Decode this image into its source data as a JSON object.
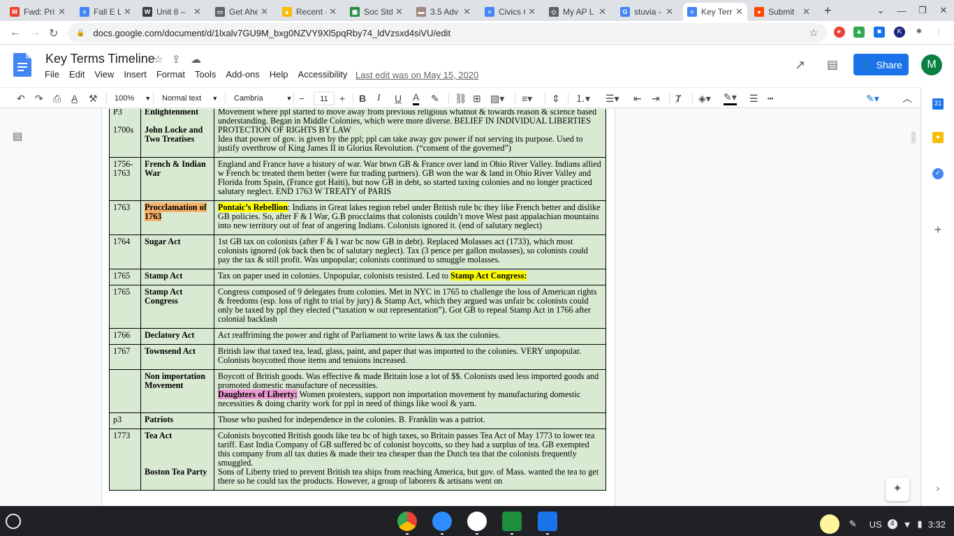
{
  "tabs": [
    {
      "title": "Fwd: Pri",
      "color": "#ea4335",
      "glyph": "M"
    },
    {
      "title": "Fall E Le",
      "color": "#4285f4",
      "glyph": "≡"
    },
    {
      "title": "Unit 8 –",
      "color": "#3c4043",
      "glyph": "W"
    },
    {
      "title": "Get Ahe",
      "color": "#5f6368",
      "glyph": "▭"
    },
    {
      "title": "Recent -",
      "color": "#fbbc04",
      "glyph": "▲"
    },
    {
      "title": "Soc Stdy",
      "color": "#1e8e3e",
      "glyph": "▣"
    },
    {
      "title": "3.5 Adv",
      "color": "#a1887f",
      "glyph": "▬"
    },
    {
      "title": "Civics C",
      "color": "#4285f4",
      "glyph": "≡"
    },
    {
      "title": "My AP L",
      "color": "#5f6368",
      "glyph": "◇"
    },
    {
      "title": "stuvia -",
      "color": "#4285f4",
      "glyph": "G"
    },
    {
      "title": "Key Terr",
      "color": "#4285f4",
      "glyph": "≡",
      "active": true
    },
    {
      "title": "Submit",
      "color": "#ff4500",
      "glyph": "●"
    }
  ],
  "browser": {
    "url": "docs.google.com/document/d/1lxalv7GU9M_bxg0NZVY9Xl5pqRby74_ldVzsxd4siVU/edit"
  },
  "doc": {
    "title": "Key Terms Timeline",
    "menu": [
      "File",
      "Edit",
      "View",
      "Insert",
      "Format",
      "Tools",
      "Add-ons",
      "Help",
      "Accessibility"
    ],
    "last_edit": "Last edit was on May 15, 2020",
    "share_label": "Share",
    "avatar_letter": "M"
  },
  "toolbar": {
    "zoom": "100%",
    "style": "Normal text",
    "font": "Cambria",
    "size": "11"
  },
  "table": {
    "rows": [
      {
        "date": "P3\n\n1700s",
        "term": "Enlightenment\n\nJohn Locke and Two Treatises",
        "desc_html": "Movement where ppl started to move away from previous religious whatnot & towards reason & science based understanding. Began in Middle Colonies, which were more diverse. BELIEF IN INDIVIDUAL LIBERTIES PROTECTION OF RIGHTS BY LAW<br>Idea that power of gov. is given by the ppl; ppl can take away gov power if not serving its purpose. Used to justify overthrow of King James II in Glorius Revolution. (“consent of the governed”)"
      },
      {
        "date": "1756-1763",
        "term": "French & Indian War",
        "desc_html": "England and France have a history of war. War btwn GB & France over land in Ohio River Valley. Indians allied w French bc treated them better (were fur trading partners). GB won the war & land in Ohio River Valley and Florida from Spain,  (France got Haiti), but now GB  in debt, so started taxing colonies and no longer practiced salutary neglect. END 1763 W TREATY of PARIS"
      },
      {
        "date": "1763",
        "term": "Procclamation of 1763",
        "term_hl": true,
        "desc_hl": "Pontaic’s Rebellion",
        "desc_html": ": Indians in Great lakes region rebel under British rule bc they like French better and dislike GB policies. So, after F & I War, G.B procclaims that colonists couldn’t move West past appalachian mountains into new territory out of fear of angering Indians. Colonists ignored it. (end of salutary neglect)"
      },
      {
        "date": "1764",
        "term": "Sugar Act",
        "desc_html": "1st GB tax on colonists (after F & I war bc now GB in debt). Replaced Molasses act (1733), which most colonists ignored (ok back then bc of salutary neglect). Tax (3 pence per gallon molasses), so colonists could pay the tax & still profit. Was unpopular; colonists continued to smuggle molasses."
      },
      {
        "date": "1765",
        "term": "Stamp Act",
        "desc_html": "Tax on paper used in colonies. Unpopular, colonists resisted. Led to ",
        "desc_tail_hl": "Stamp Act Congress:"
      },
      {
        "date": "1765",
        "term": "Stamp Act Congress",
        "desc_html": "Congress composed of 9 delegates from colonies. Met in NYC in 1765 to challenge the loss of American rights & freedoms (esp. loss of right to trial by jury) & Stamp Act, which they argued was unfair bc colonists could only be taxed by ppl they elected (“taxation w out representation”). Got GB to repeal Stamp Act in 1766 after colonial backlash"
      },
      {
        "date": "1766",
        "term": "Declatory Act",
        "desc_html": "Act reaffriming the power and right of Parliament to write laws & tax the colonies."
      },
      {
        "date": "1767",
        "term": "Townsend Act",
        "desc_html": "British law that taxed tea, lead, glass, paint, and paper that was imported to the colonies. VERY unpopular. Colonists boycotted those items and tensions increased."
      },
      {
        "date": "",
        "term": "Non importation Movement",
        "desc_html": "Boycott of British goods. Was effective & made Britain lose a lot of $$. Colonists used less imported goods and promoted domestic manufacture of necessities.",
        "desc_pink": "Daughters of Liberty:",
        "desc_pink_tail": " Women protesters, support non importation movement by manufacturing domestic necessities & doing charity work for ppl in need of things like wool & yarn."
      },
      {
        "date": "p3",
        "term": "Patriots",
        "desc_html": "Those who pushed for independence in the colonies. B. Franklin was a patriot."
      },
      {
        "date": "1773",
        "term": "Tea Act\n\n\n\nBoston Tea Party",
        "desc_html": "Colonists boycotted British goods like tea bc of high taxes, so Britain passes Tea Act of May 1773 to lower tea tariff. East India Company of GB suffered bc of colonist boycotts, so they had a surplus of tea. GB exempted this company from all tax duties & made their tea cheaper than the Dutch tea that the colonists frequently smuggled.<br>Sons of Liberty tried to prevent British tea ships from reaching America, but gov. of Mass. wanted the tea to get there so he could tax the products. However, a group of laborers & artisans went on"
      }
    ]
  },
  "shelf": {
    "input_method": "US",
    "notification_count": "4",
    "time": "3:32"
  }
}
